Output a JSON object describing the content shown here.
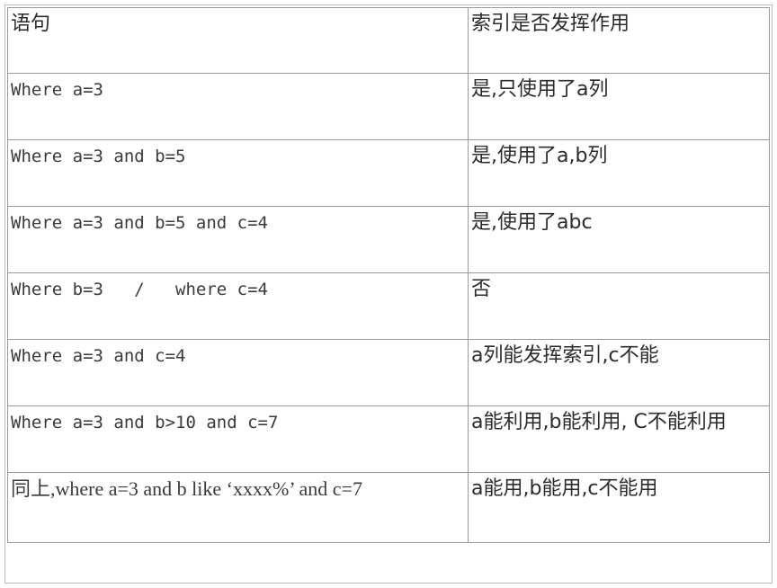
{
  "table": {
    "headers": [
      "语句",
      "索引是否发挥作用"
    ],
    "rows": [
      {
        "statement": "Where a=3",
        "result": "是,只使用了a列"
      },
      {
        "statement": "Where a=3 and b=5",
        "result": "是,使用了a,b列"
      },
      {
        "statement": "Where a=3 and b=5 and c=4",
        "result": "是,使用了abc"
      },
      {
        "statement": "Where b=3   /   where c=4",
        "result": "否"
      },
      {
        "statement": "Where a=3 and c=4",
        "result": "a列能发挥索引,c不能"
      },
      {
        "statement": "Where a=3 and b>10 and c=7",
        "result": "a能利用,b能利用, C不能利用"
      },
      {
        "statement": "同上,where a=3 and b like ‘xxxx%’   and c=7",
        "result": "a能用,b能用,c不能用"
      }
    ]
  }
}
